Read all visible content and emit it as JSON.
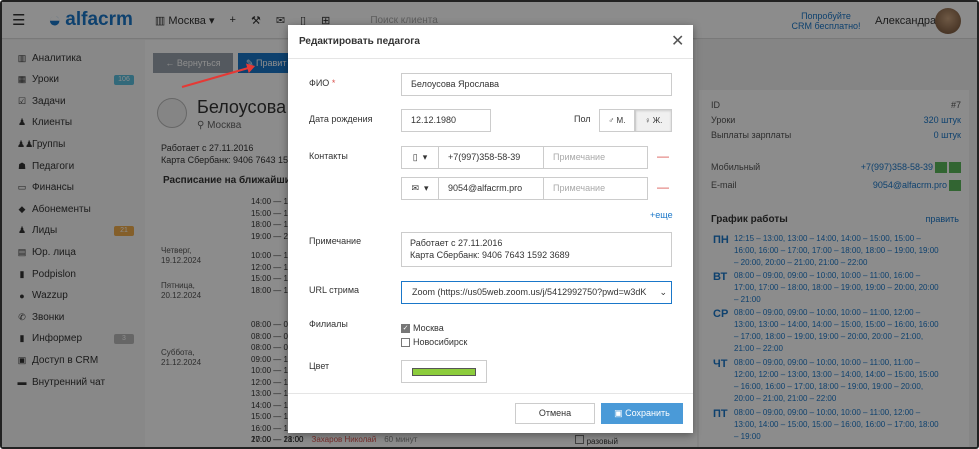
{
  "header": {
    "brand": "alfacrm",
    "branch": "Москва",
    "search_placeholder": "Поиск клиента",
    "promo_line1": "Попробуйте",
    "promo_line2": "CRM бесплатно!",
    "user_name": "Александра"
  },
  "sidebar": {
    "items": [
      {
        "label": "Аналитика",
        "icon": "chart-icon"
      },
      {
        "label": "Уроки",
        "icon": "calendar-icon",
        "badge": "106",
        "badge_color": "#5bc0de"
      },
      {
        "label": "Задачи",
        "icon": "tasks-icon"
      },
      {
        "label": "Клиенты",
        "icon": "user-icon"
      },
      {
        "label": "Группы",
        "icon": "users-icon"
      },
      {
        "label": "Педагоги",
        "icon": "teacher-icon"
      },
      {
        "label": "Финансы",
        "icon": "money-icon"
      },
      {
        "label": "Абонементы",
        "icon": "tag-icon"
      },
      {
        "label": "Лиды",
        "icon": "lead-icon",
        "badge": "21",
        "badge_color": "#f0ad4e"
      },
      {
        "label": "Юр. лица",
        "icon": "building-icon"
      },
      {
        "label": "Podpislon",
        "icon": "doc-icon"
      },
      {
        "label": "Wazzup",
        "icon": "whatsapp-icon"
      },
      {
        "label": "Звонки",
        "icon": "phone-icon"
      },
      {
        "label": "Информер",
        "icon": "doc-icon",
        "badge": "3",
        "badge_color": "#bbbbbb"
      },
      {
        "label": "Доступ в CRM",
        "icon": "lock-icon"
      },
      {
        "label": "Внутренний чат",
        "icon": "chat-icon"
      }
    ]
  },
  "page": {
    "back_label": "← Вернуться",
    "edit_label": "Правит",
    "teacher_name": "Белоусова Я",
    "teacher_city": "Москва",
    "note_line1": "Работает с 27.11.2016",
    "note_line2": "Карта Сбербанк: 9406 7643 15",
    "schedule_title": "Расписание на ближайши",
    "days": [
      {
        "day": "Четверг,",
        "date": "19.12.2024",
        "times": [
          "14:00 — 15:00",
          "15:00 — 16:00",
          "18:00 — 19:00",
          "19:00 — 20:00"
        ]
      },
      {
        "day": "Пятница,",
        "date": "20.12.2024",
        "times": [
          "10:00 — 11:00",
          "12:00 — 13:00",
          "15:00 — 16:00",
          "18:00 — 19:00"
        ]
      },
      {
        "day": "Суббота,",
        "date": "21.12.2024",
        "times": [
          "08:00 — 09:00",
          "08:00 — 09:00",
          "08:00 — 09:00",
          "09:00 — 10:00",
          "10:00 — 11:00",
          "12:00 — 13:00",
          "13:00 — 14:00",
          "14:00 — 15:00",
          "15:00 — 16:00",
          "16:00 — 17:00",
          "17:00 — 18:00",
          "19:00 — 20:00"
        ]
      }
    ],
    "last_row": {
      "time": "20:00 — 21:00",
      "teacher": "Захаров Николай",
      "duration": "60 минут",
      "type": "разовый"
    }
  },
  "right_panel": {
    "id_label": "ID",
    "id_value": "#7",
    "lessons_label": "Уроки",
    "lessons_value": "320 штук",
    "payouts_label": "Выплаты зарплаты",
    "payouts_value": "0 штук",
    "mobile_label": "Мобильный",
    "mobile_value": "+7(997)358-58-39",
    "email_label": "E-mail",
    "email_value": "9054@alfacrm.pro",
    "schedule_title": "График работы",
    "schedule_edit": "править",
    "week": [
      {
        "day": "ПН",
        "text": "12:15 – 13:00, 13:00 – 14:00, 14:00 – 15:00, 15:00 – 16:00, 16:00 – 17:00, 17:00 – 18:00, 18:00 – 19:00, 19:00 – 20:00, 20:00 – 21:00, 21:00 – 22:00"
      },
      {
        "day": "ВТ",
        "text": "08:00 – 09:00, 09:00 – 10:00, 10:00 – 11:00, 16:00 – 17:00, 17:00 – 18:00, 18:00 – 19:00, 19:00 – 20:00, 20:00 – 21:00"
      },
      {
        "day": "СР",
        "text": "08:00 – 09:00, 09:00 – 10:00, 10:00 – 11:00, 12:00 – 13:00, 13:00 – 14:00, 14:00 – 15:00, 15:00 – 16:00, 16:00 – 17:00, 18:00 – 19:00, 19:00 – 20:00, 20:00 – 21:00, 21:00 – 22:00"
      },
      {
        "day": "ЧТ",
        "text": "08:00 – 09:00, 09:00 – 10:00, 10:00 – 11:00, 11:00 – 12:00, 12:00 – 13:00, 13:00 – 14:00, 14:00 – 15:00, 15:00 – 16:00, 16:00 – 17:00, 18:00 – 19:00, 19:00 – 20:00, 20:00 – 21:00, 21:00 – 22:00"
      },
      {
        "day": "ПТ",
        "text": "08:00 – 09:00, 09:00 – 10:00, 10:00 – 11:00, 12:00 – 13:00, 14:00 – 15:00, 15:00 – 16:00, 16:00 – 17:00, 18:00 – 19:00"
      }
    ]
  },
  "modal": {
    "title": "Редактировать педагога",
    "fio_label": "ФИО",
    "fio_value": "Белоусова Ярослава",
    "birth_label": "Дата рождения",
    "birth_value": "12.12.1980",
    "gender_label": "Пол",
    "gender_m": "М.",
    "gender_f": "Ж.",
    "contacts_label": "Контакты",
    "phone_value": "+7(997)358-58-39",
    "email_value": "9054@alfacrm.pro",
    "note_placeholder": "Примечание",
    "more_label": "+еще",
    "note_label": "Примечание",
    "note_line1": "Работает с 27.11.2016",
    "note_line2": "Карта Сбербанк: 9406 7643 1592 3689",
    "url_label": "URL стрима",
    "url_value": "Zoom (https://us05web.zoom.us/j/5412992750?pwd=w3dK",
    "branches_label": "Филиалы",
    "branch1": "Москва",
    "branch2": "Новосибирск",
    "color_label": "Цвет",
    "color_value": "#8ccc3c",
    "cancel_label": "Отмена",
    "save_label": "Сохранить"
  }
}
